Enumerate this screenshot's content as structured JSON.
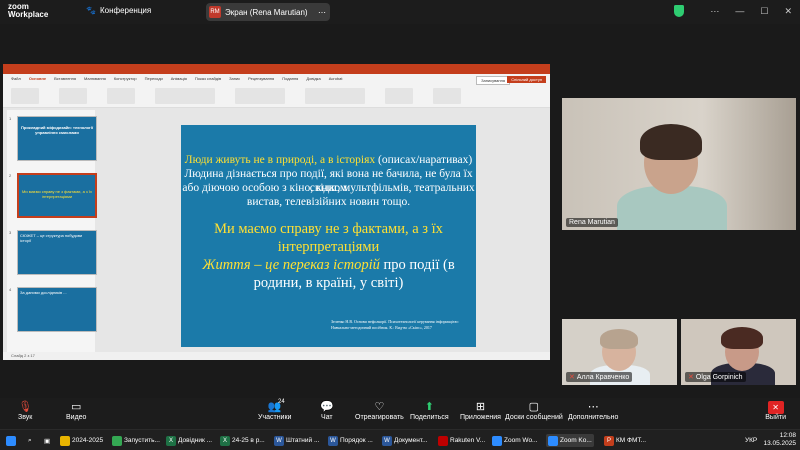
{
  "app": {
    "logo_line1": "zoom",
    "logo_line2": "Workplace",
    "conference_label": "Конференция",
    "screen_share_label": "Экран (Rena Marutian)",
    "presenter_initials": "RM"
  },
  "slide": {
    "line1_white": "Люди живуть не в природі, а в історіях",
    "line1_suffix": " (описах/наративах)",
    "line2": "Людина дізнається про події, які вона не бачила, не була їх свідком",
    "line3": "або діючою особою з кіно, книг, мультфільмів, театральних",
    "line4": "вистав, телевізійних новин тощо.",
    "big1": "Ми маємо справу не з фактами, а з їх",
    "big2": "інтерпретаціями",
    "big3_yellow": "Життя – це переказ історій",
    "big3_white": " про події  (в",
    "big4": "родини, в країні, у світі)",
    "reference": "Зеленко Н.В. Основи нефолкорії. Психотехнології керування інформацією: Навчально-методичний посібник. К.: Вид-во «Скіпс», 2017"
  },
  "thumbnails": [
    {
      "num": "1",
      "text": "Прикладний міфодизайн: технології управління смислами"
    },
    {
      "num": "2",
      "text": "Ми маємо справу не з фактами, а з їх інтерпретаціями"
    },
    {
      "num": "3",
      "text": "СЮЖЕТ – це структура побудови історії"
    },
    {
      "num": "4",
      "text": "За даними дослідників ..."
    }
  ],
  "ppt": {
    "tabs": [
      "Файл",
      "Основне",
      "Вставлення",
      "Малювання",
      "Конструктор",
      "Переходи",
      "Анімація",
      "Показ слайдів",
      "Запис",
      "Рецензування",
      "Подання",
      "Довідка",
      "Acrobat"
    ],
    "record_label": "Записування",
    "share_label": "Спільний доступ",
    "status": "Слайд 2 з 17"
  },
  "participants_video": [
    {
      "name": "Rena Marutian",
      "mic_muted": false
    },
    {
      "name": "Алла Кравченко",
      "mic_muted": true
    },
    {
      "name": "Olga Gorpinich",
      "mic_muted": true
    }
  ],
  "toolbar": {
    "mute_label": "Звук",
    "video_label": "Видео",
    "participants_label": "Участники",
    "participants_count": "24",
    "chat_label": "Чат",
    "react_label": "Отреагировать",
    "share_label": "Поделиться",
    "apps_label": "Приложения",
    "whiteboards_label": "Доски сообщений",
    "more_label": "Дополнительно",
    "exit_label": "Выйти"
  },
  "taskbar": {
    "items": [
      {
        "label": "2024-2025",
        "color": "#e8b400"
      },
      {
        "label": "Запустить...",
        "color": "#34a853"
      },
      {
        "label": "Довідник ...",
        "color": "#1e7145"
      },
      {
        "label": "24-25 в р...",
        "color": "#1e7145"
      },
      {
        "label": "Штатний ...",
        "color": "#2b579a"
      },
      {
        "label": "Порядок ...",
        "color": "#2b579a"
      },
      {
        "label": "Документ...",
        "color": "#2b579a"
      },
      {
        "label": "Rakuten V...",
        "color": "#bf0000"
      },
      {
        "label": "Zoom Wo...",
        "color": "#2d8cff"
      },
      {
        "label": "Zoom Ko...",
        "color": "#2d8cff"
      },
      {
        "label": "КМ ФМТ...",
        "color": "#c43e1c"
      }
    ],
    "language": "УКР",
    "time": "12:08",
    "date": "13.05.2025"
  }
}
